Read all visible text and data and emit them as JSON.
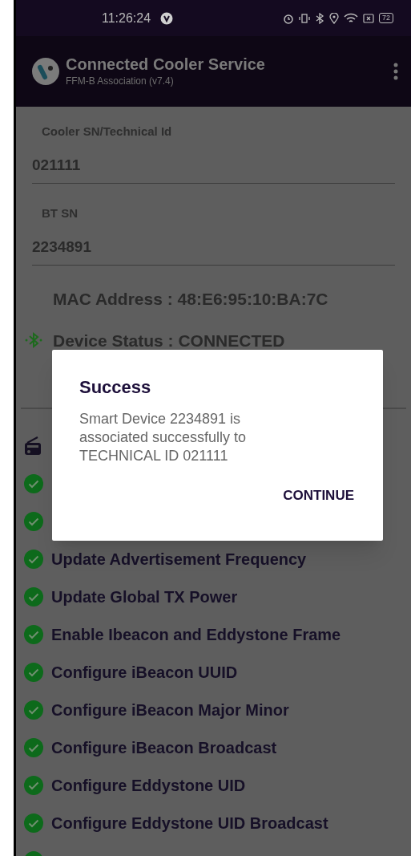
{
  "status_bar": {
    "time": "11:26:24",
    "battery": "72"
  },
  "app_bar": {
    "title": "Connected Cooler Service",
    "subtitle": "FFM-B Association (v7.4)"
  },
  "fields": [
    {
      "label": "Cooler SN/Technical Id",
      "value": "021111"
    },
    {
      "label": "BT SN",
      "value": "2234891"
    }
  ],
  "mac_address": "MAC Address : 48:E6:95:10:BA:7C",
  "device_status": "Device Status : CONNECTED",
  "steps": [
    {
      "kind": "header"
    },
    {
      "kind": "done"
    },
    {
      "kind": "done"
    },
    {
      "kind": "done",
      "label": "Update Advertisement Frequency"
    },
    {
      "kind": "done",
      "label": "Update Global TX Power"
    },
    {
      "kind": "done",
      "label": "Enable Ibeacon and Eddystone Frame"
    },
    {
      "kind": "done",
      "label": "Configure iBeacon UUID"
    },
    {
      "kind": "done",
      "label": "Configure iBeacon Major Minor"
    },
    {
      "kind": "done",
      "label": "Configure iBeacon Broadcast"
    },
    {
      "kind": "done",
      "label": "Configure Eddystone UID"
    },
    {
      "kind": "done",
      "label": "Configure Eddystone UID Broadcast"
    },
    {
      "kind": "done"
    }
  ],
  "dialog": {
    "title": "Success",
    "message": "Smart Device 2234891 is associated successfully to TECHNICAL ID 021111",
    "button": "CONTINUE"
  }
}
